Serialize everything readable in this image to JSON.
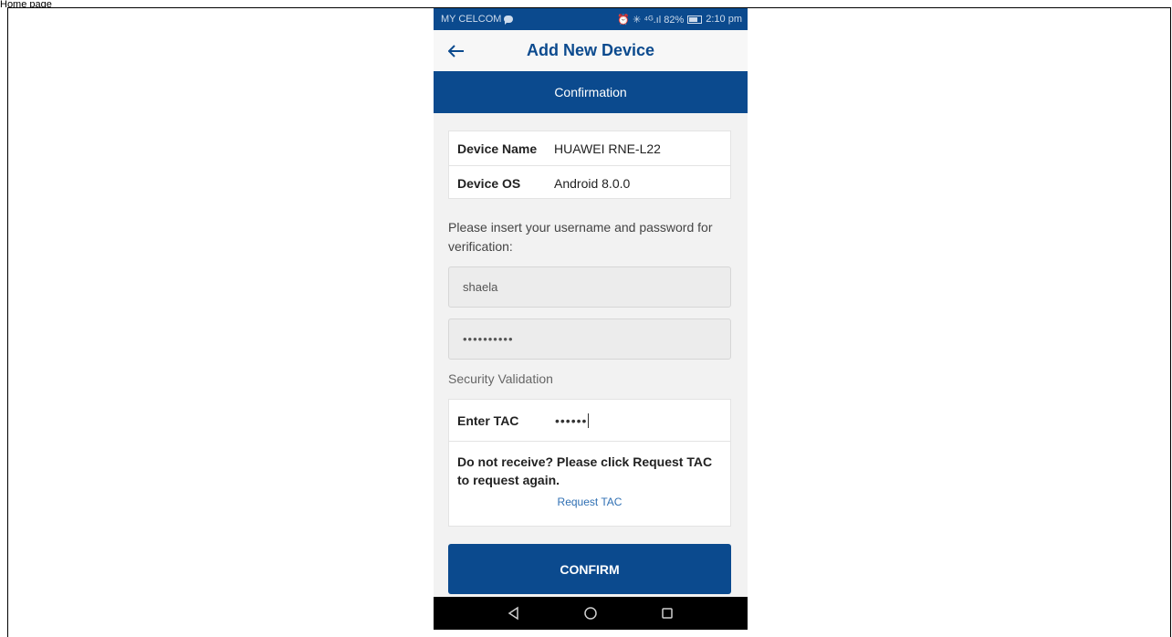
{
  "page_label": "Home page",
  "status_bar": {
    "carrier": "MY CELCOM",
    "indicators": "⏰ ✳ ⁴ᴳ.ıl 82%",
    "time": "2:10 pm",
    "icons": [
      "chat-icon",
      "alarm-icon",
      "signal-icon",
      "battery-icon"
    ]
  },
  "header": {
    "title": "Add New Device",
    "back_icon": "arrow-left-icon"
  },
  "step": {
    "label": "Confirmation"
  },
  "device_info": {
    "name_label": "Device Name",
    "name_value": "HUAWEI RNE-L22",
    "os_label": "Device OS",
    "os_value": "Android 8.0.0"
  },
  "verification": {
    "prompt": "Please insert your username and password for verification:",
    "username_value": "shaela",
    "password_value": "••••••••••"
  },
  "security": {
    "label": "Security Validation",
    "tac_label": "Enter TAC",
    "tac_value": "••••••",
    "note": "Do not receive? Please click Request TAC to request again.",
    "request_link": "Request TAC"
  },
  "confirm_button": "CONFIRM",
  "nav_bar": {
    "icons": [
      "back-triangle-icon",
      "home-circle-icon",
      "recents-square-icon"
    ]
  },
  "colors": {
    "primary": "#0b4a8e",
    "link": "#2f6fb3",
    "background": "#f2f2f2"
  }
}
